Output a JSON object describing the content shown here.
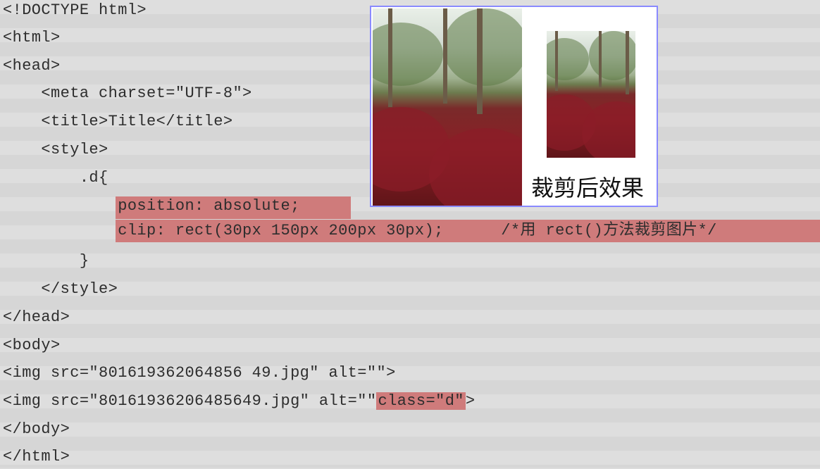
{
  "code": {
    "lines": [
      "<!DOCTYPE html>",
      "<html>",
      "<head>",
      "    <meta charset=\"UTF-8\">",
      "    <title>Title</title>",
      "    <style>",
      "        .d{",
      "            position: absolute;",
      "            clip: rect(30px 150px 200px 30px);      /*用 rect()方法裁剪图片*/",
      "        }",
      "    </style>",
      "</head>",
      "<body>",
      "<img src=\"801619362064856 49.jpg\" alt=\"\">",
      "<img src=\"80161936206485649.jpg\" alt=\"\"",
      "</body>",
      "</html>"
    ],
    "line14_suffix_hl": "class=\"d\"",
    "line14_suffix_tail": ">"
  },
  "panel": {
    "caption": "裁剪后效果",
    "border_color": "#8a8aff"
  },
  "highlight_color": "#cf7b7b"
}
